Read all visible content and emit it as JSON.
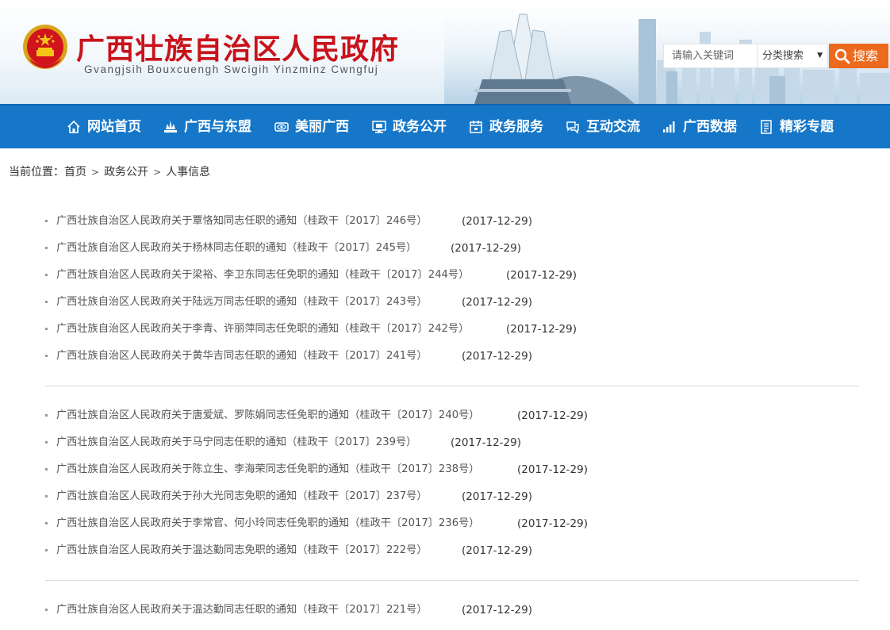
{
  "header": {
    "title": "广西壮族自治区人民政府",
    "subtitle": "Gvangjsih Bouxcuengh Swcigih Yinzminz Cwngfuj",
    "search_placeholder": "请输入关键词",
    "category_label": "分类搜索",
    "category_caret": "▼",
    "search_button": "搜索"
  },
  "nav": {
    "items": [
      {
        "label": "网站首页",
        "icon": "home-icon"
      },
      {
        "label": "广西与东盟",
        "icon": "landmark-icon"
      },
      {
        "label": "美丽广西",
        "icon": "eye-icon"
      },
      {
        "label": "政务公开",
        "icon": "monitor-icon"
      },
      {
        "label": "政务服务",
        "icon": "calendar-icon"
      },
      {
        "label": "互动交流",
        "icon": "chat-icon"
      },
      {
        "label": "广西数据",
        "icon": "bar-chart-icon"
      },
      {
        "label": "精彩专题",
        "icon": "document-icon"
      }
    ]
  },
  "breadcrumb": {
    "prefix": "当前位置：",
    "items": [
      "首页",
      "政务公开",
      "人事信息"
    ],
    "separator": ">"
  },
  "news": [
    {
      "title": "广西壮族自治区人民政府关于覃恪知同志任职的通知（桂政干〔2017〕246号）",
      "date": "(2017-12-29)"
    },
    {
      "title": "广西壮族自治区人民政府关于杨林同志任职的通知（桂政干〔2017〕245号）",
      "date": "(2017-12-29)"
    },
    {
      "title": "广西壮族自治区人民政府关于梁裕、李卫东同志任免职的通知（桂政干〔2017〕244号）",
      "date": "(2017-12-29)"
    },
    {
      "title": "广西壮族自治区人民政府关于陆远万同志任职的通知（桂政干〔2017〕243号）",
      "date": "(2017-12-29)"
    },
    {
      "title": "广西壮族自治区人民政府关于李青、许丽萍同志任免职的通知（桂政干〔2017〕242号）",
      "date": "(2017-12-29)"
    },
    {
      "title": "广西壮族自治区人民政府关于黄华吉同志任职的通知（桂政干〔2017〕241号）",
      "date": "(2017-12-29)"
    },
    {
      "title": "广西壮族自治区人民政府关于唐爱斌、罗陈娟同志任免职的通知（桂政干〔2017〕240号）",
      "date": "(2017-12-29)"
    },
    {
      "title": "广西壮族自治区人民政府关于马宁同志任职的通知（桂政干〔2017〕239号）",
      "date": "(2017-12-29)"
    },
    {
      "title": "广西壮族自治区人民政府关于陈立生、李海荣同志任免职的通知（桂政干〔2017〕238号）",
      "date": "(2017-12-29)"
    },
    {
      "title": "广西壮族自治区人民政府关于孙大光同志免职的通知（桂政干〔2017〕237号）",
      "date": "(2017-12-29)"
    },
    {
      "title": "广西壮族自治区人民政府关于李常官、何小玲同志任免职的通知（桂政干〔2017〕236号）",
      "date": "(2017-12-29)"
    },
    {
      "title": "广西壮族自治区人民政府关于温达勤同志免职的通知（桂政干〔2017〕222号）",
      "date": "(2017-12-29)"
    },
    {
      "title": "广西壮族自治区人民政府关于温达勤同志任职的通知（桂政干〔2017〕221号）",
      "date": "(2017-12-29)"
    }
  ]
}
